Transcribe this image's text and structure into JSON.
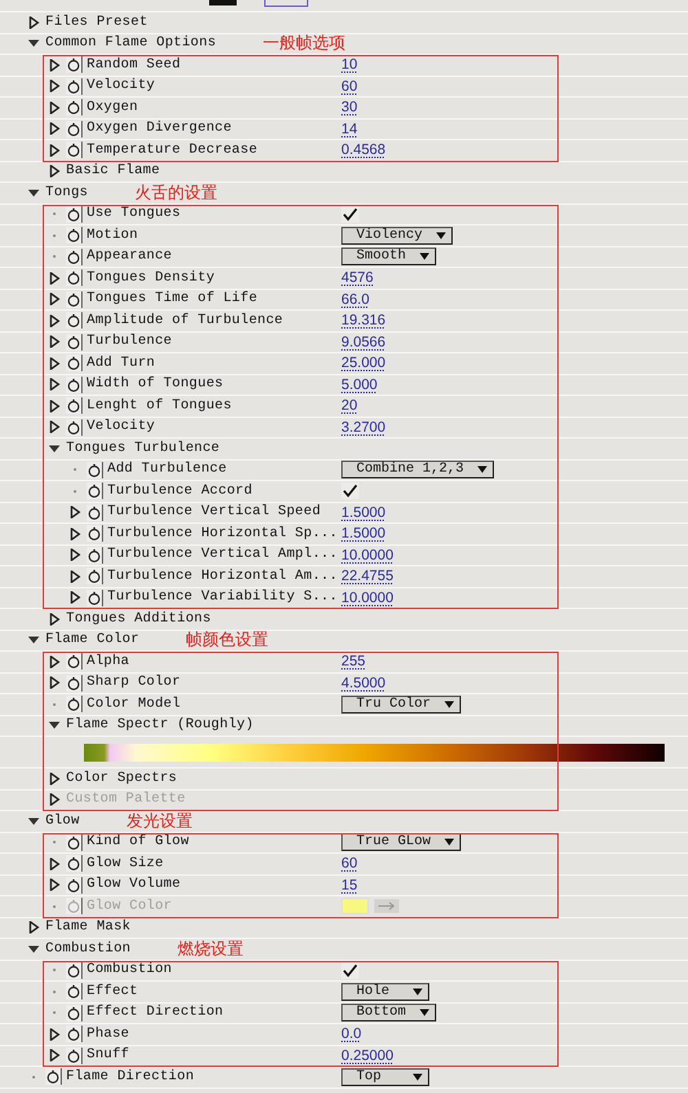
{
  "rows": [
    {
      "kind": "group",
      "label": "Files Preset",
      "expanded": false,
      "disabled": false
    },
    {
      "kind": "group",
      "label": "Common Flame Options",
      "expanded": true,
      "disabled": false,
      "note": "一般帧选项",
      "children": [
        {
          "kind": "number",
          "label": "Random Seed",
          "value": "10",
          "disabled": false,
          "boxed": true
        },
        {
          "kind": "number",
          "label": "Velocity",
          "value": "60",
          "disabled": false,
          "boxed": true
        },
        {
          "kind": "number",
          "label": "Oxygen",
          "value": "30",
          "disabled": false,
          "boxed": true
        },
        {
          "kind": "number",
          "label": "Oxygen Divergence",
          "value": "14",
          "disabled": false,
          "boxed": true
        },
        {
          "kind": "number",
          "label": "Temperature Decrease",
          "value": "0.4568",
          "disabled": false,
          "boxed": true
        },
        {
          "kind": "group",
          "label": "Basic Flame",
          "expanded": false,
          "disabled": false,
          "boxed": false
        }
      ]
    },
    {
      "kind": "group",
      "label": "Tongs",
      "expanded": true,
      "disabled": false,
      "note": "火舌的设置",
      "children": [
        {
          "kind": "checkbox",
          "label": "Use Tongues",
          "checked": true,
          "disabled": false,
          "boxed": true
        },
        {
          "kind": "dropdown",
          "label": "Motion",
          "value": "Violency",
          "disabled": false,
          "boxed": true
        },
        {
          "kind": "dropdown",
          "label": "Appearance",
          "value": "Smooth",
          "disabled": false,
          "boxed": true
        },
        {
          "kind": "number",
          "label": "Tongues Density",
          "value": "4576",
          "disabled": false,
          "boxed": true
        },
        {
          "kind": "number",
          "label": "Tongues Time of Life",
          "value": "66.0",
          "disabled": false,
          "boxed": true
        },
        {
          "kind": "number",
          "label": "Amplitude of Turbulence",
          "value": "19.316",
          "disabled": false,
          "boxed": true
        },
        {
          "kind": "number",
          "label": "Turbulence",
          "value": "9.0566",
          "disabled": false,
          "boxed": true
        },
        {
          "kind": "number",
          "label": "Add Turn",
          "value": "25.000",
          "disabled": false,
          "boxed": true
        },
        {
          "kind": "number",
          "label": "Width of Tongues",
          "value": "5.000",
          "disabled": false,
          "boxed": true
        },
        {
          "kind": "number",
          "label": "Lenght of Tongues",
          "value": "20",
          "disabled": false,
          "boxed": true
        },
        {
          "kind": "number",
          "label": "Velocity",
          "value": "3.2700",
          "disabled": false,
          "boxed": true
        },
        {
          "kind": "group",
          "label": "Tongues Turbulence",
          "expanded": true,
          "disabled": false,
          "boxed": true,
          "children": [
            {
              "kind": "dropdown",
              "label": "Add Turbulence",
              "value": "Combine 1,2,3",
              "disabled": false
            },
            {
              "kind": "checkbox",
              "label": "Turbulence Accord",
              "checked": true,
              "disabled": false
            },
            {
              "kind": "number",
              "label": "Turbulence Vertical Speed",
              "value": "1.5000",
              "disabled": false
            },
            {
              "kind": "number",
              "label": "Turbulence Horizontal Sp...",
              "value": "1.5000",
              "disabled": false
            },
            {
              "kind": "number",
              "label": "Turbulence Vertical Ampl...",
              "value": "10.0000",
              "disabled": false
            },
            {
              "kind": "number",
              "label": "Turbulence Horizontal Am...",
              "value": "22.4755",
              "disabled": false
            },
            {
              "kind": "number",
              "label": "Turbulence Variability S...",
              "value": "10.0000",
              "disabled": false
            }
          ]
        },
        {
          "kind": "group",
          "label": "Tongues Additions",
          "expanded": false,
          "disabled": false,
          "boxed": false
        }
      ]
    },
    {
      "kind": "group",
      "label": "Flame Color",
      "expanded": true,
      "disabled": false,
      "note": "帧颜色设置",
      "children": [
        {
          "kind": "number",
          "label": "Alpha",
          "value": "255",
          "disabled": false,
          "boxed": true
        },
        {
          "kind": "number",
          "label": "Sharp Color",
          "value": "4.5000",
          "disabled": false,
          "boxed": true
        },
        {
          "kind": "dropdown",
          "label": "Color Model",
          "value": "Tru Color",
          "disabled": false,
          "boxed": true
        },
        {
          "kind": "group",
          "label": "Flame Spectr (Roughly)",
          "expanded": true,
          "disabled": false,
          "boxed": true,
          "children": [
            {
              "kind": "spectrum"
            }
          ]
        },
        {
          "kind": "group",
          "label": "Color Spectrs",
          "expanded": false,
          "disabled": false,
          "boxed": true
        },
        {
          "kind": "group",
          "label": "Custom Palette",
          "expanded": false,
          "disabled": true,
          "boxed": true
        }
      ]
    },
    {
      "kind": "group",
      "label": "Glow",
      "expanded": true,
      "disabled": false,
      "note": "发光设置",
      "children": [
        {
          "kind": "dropdown",
          "label": "Kind of Glow",
          "value": "True GLow",
          "disabled": false,
          "boxed": true
        },
        {
          "kind": "number",
          "label": "Glow Size",
          "value": "60",
          "disabled": false,
          "boxed": true
        },
        {
          "kind": "number",
          "label": "Glow Volume",
          "value": "15",
          "disabled": false,
          "boxed": true
        },
        {
          "kind": "color",
          "label": "Glow Color",
          "color": "#f8f880",
          "disabled": true,
          "boxed": true
        }
      ]
    },
    {
      "kind": "group",
      "label": "Flame Mask",
      "expanded": false,
      "disabled": false
    },
    {
      "kind": "group",
      "label": "Combustion",
      "expanded": true,
      "disabled": false,
      "note": "燃烧设置",
      "children": [
        {
          "kind": "checkbox",
          "label": "Combustion",
          "checked": true,
          "disabled": false,
          "boxed": true
        },
        {
          "kind": "dropdown",
          "label": "Effect",
          "value": "Hole",
          "disabled": false,
          "boxed": true
        },
        {
          "kind": "dropdown",
          "label": "Effect Direction",
          "value": "Bottom",
          "disabled": false,
          "boxed": true
        },
        {
          "kind": "number",
          "label": "Phase",
          "value": "0.0",
          "disabled": false,
          "boxed": true
        },
        {
          "kind": "number",
          "label": "Snuff",
          "value": "0.25000",
          "disabled": false,
          "boxed": true
        }
      ]
    },
    {
      "kind": "dropdown",
      "label": "Flame Direction",
      "value": "Top",
      "disabled": false
    }
  ]
}
